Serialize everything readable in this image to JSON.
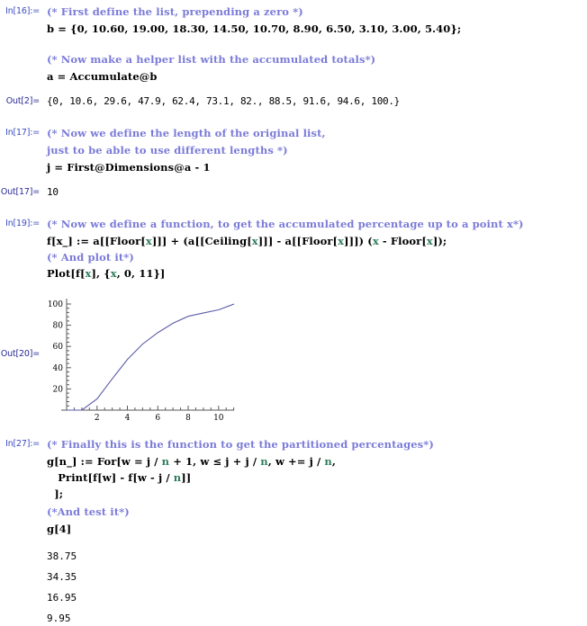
{
  "notebook": {
    "cells": [
      {
        "prompt": "In[16]:=",
        "lines": [
          {
            "kind": "comment",
            "text": "(* First define the list, prepending a zero *)"
          },
          {
            "kind": "code",
            "text": "b = {0, 10.60, 19.00, 18.30, 14.50, 10.70, 8.90, 6.50, 3.10, 3.00, 5.40};"
          },
          {
            "kind": "blank",
            "text": ""
          },
          {
            "kind": "comment",
            "text": "(* Now make a helper list with the accumulated totals*)"
          },
          {
            "kind": "code",
            "text": "a = Accumulate@b"
          }
        ]
      },
      {
        "prompt": "Out[2]=",
        "lines": [
          {
            "kind": "out",
            "text": "{0, 10.6, 29.6, 47.9, 62.4, 73.1, 82., 88.5, 91.6, 94.6, 100.}"
          }
        ]
      },
      {
        "prompt": "In[17]:=",
        "lines": [
          {
            "kind": "comment",
            "text": "(* Now we define the length of the original list,"
          },
          {
            "kind": "comment",
            "text": "just to be able to use different lengths *)"
          },
          {
            "kind": "code",
            "text": "j = First@Dimensions@a - 1"
          }
        ]
      },
      {
        "prompt": "Out[17]=",
        "lines": [
          {
            "kind": "out",
            "text": "10"
          }
        ]
      },
      {
        "prompt": "In[19]:=",
        "lines": [
          {
            "kind": "comment",
            "text": "(* Now we define a function, to get the accumulated percentage up to a point x*)"
          },
          {
            "kind": "code",
            "text": "f[x_] := a[[Floor[x]]] + (a[[Ceiling[x]]] - a[[Floor[x]]]) (x - Floor[x]);"
          },
          {
            "kind": "comment",
            "text": "(* And plot it*)"
          },
          {
            "kind": "code",
            "text": "Plot[f[x], {x, 0, 11}]"
          }
        ]
      },
      {
        "prompt": "In[27]:=",
        "lines": [
          {
            "kind": "comment",
            "text": "(* Finally this is the function to get the partitioned percentages*)"
          },
          {
            "kind": "code",
            "text": "g[n_] := For[w = j / n + 1, w ≤ j + j / n, w += j / n,"
          },
          {
            "kind": "code",
            "text": "   Print[f[w] - f[w - j / n]]"
          },
          {
            "kind": "code",
            "text": "  ];"
          },
          {
            "kind": "comment",
            "text": "(*And test it*)"
          },
          {
            "kind": "code",
            "text": "g[4]"
          }
        ]
      }
    ],
    "plot_prompt": "Out[20]=",
    "print_outputs": [
      "38.75",
      "34.35",
      "16.95",
      "9.95"
    ]
  },
  "chart_data": {
    "type": "line",
    "title": "",
    "xlabel": "",
    "ylabel": "",
    "xlim": [
      0,
      11
    ],
    "ylim": [
      0,
      100
    ],
    "xticks": [
      2,
      4,
      6,
      8,
      10
    ],
    "yticks": [
      20,
      40,
      60,
      80,
      100
    ],
    "grid": false,
    "legend": "none",
    "line_color": "#5c5ca8",
    "axis_color": "#5a5a5a",
    "series": [
      {
        "name": "f[x]",
        "x": [
          0,
          1,
          2,
          3,
          4,
          5,
          6,
          7,
          8,
          9,
          10,
          11
        ],
        "values": [
          0,
          0,
          10.6,
          29.6,
          47.9,
          62.4,
          73.1,
          82.0,
          88.5,
          91.6,
          94.6,
          100.0
        ]
      }
    ]
  }
}
